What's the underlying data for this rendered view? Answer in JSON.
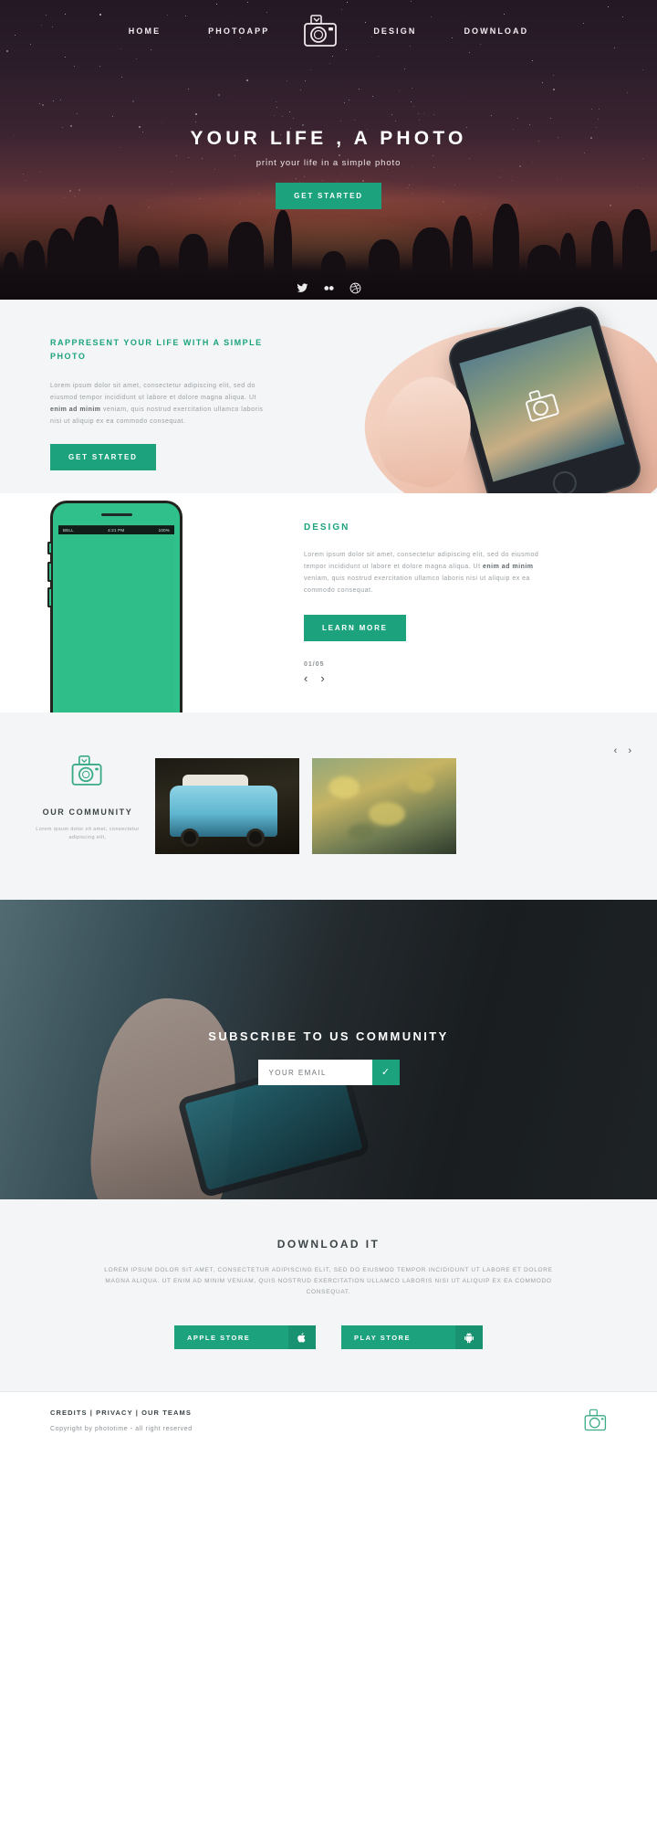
{
  "theme": {
    "accent": "#1CA37E",
    "light_bg": "#f3f5f6",
    "dark_text": "#3d4548"
  },
  "nav": {
    "logo_icon": "camera-icon",
    "items": [
      {
        "label": "HOME"
      },
      {
        "label": "PHOTOAPP"
      },
      {
        "label": "DESIGN"
      },
      {
        "label": "DOWNLOAD"
      }
    ]
  },
  "hero": {
    "title": "YOUR LIFE , A PHOTO",
    "subtitle": "print your life in a simple photo",
    "cta_label": "GET STARTED",
    "social": [
      {
        "name": "twitter-icon"
      },
      {
        "name": "flickr-icon"
      },
      {
        "name": "dribbble-icon"
      }
    ]
  },
  "rappresent": {
    "eyebrow": "RAPPRESENT YOUR LIFE WITH A SIMPLE PHOTO",
    "paragraph_pre": "Lorem ipsum dolor sit amet, consectetur adipiscing elit, sed do eiusmod tempor incididunt ut labore et dolore magna aliqua. Ut ",
    "paragraph_bold": "enim ad minim",
    "paragraph_post": " veniam, quis nostrud exercitation ullamco laboris nisi ut aliquip ex ea commodo consequat.",
    "cta_label": "GET STARTED"
  },
  "design": {
    "title": "DESIGN",
    "paragraph_pre": "Lorem ipsum dolor sit amet, consectetur adipiscing elit, sed do eiusmod tempor incididunt ut labore et dolore magna aliqua. Ut ",
    "paragraph_bold": "enim ad minim",
    "paragraph_post": " veniam, quis nostrud exercitation ullamco laboris nisi ut aliquip ex ea commodo consequat.",
    "cta_label": "LEARN MORE",
    "carousel_count": "01/05",
    "prev_arrow": "‹",
    "next_arrow": "›",
    "phone_status": {
      "carrier": "BELL",
      "time": "4:21 PM",
      "battery": "100%"
    }
  },
  "community": {
    "icon": "camera-icon",
    "title": "OUR COMMUNITY",
    "paragraph": "Lorem ipsum dolor sit amet, consectetur adipiscing elit,",
    "prev_arrow": "‹",
    "next_arrow": "›",
    "cards": [
      {
        "name": "van-photo"
      },
      {
        "name": "leaves-photo"
      }
    ]
  },
  "subscribe": {
    "title": "SUBSCRIBE TO US COMMUNITY",
    "input_placeholder": "YOUR EMAIL",
    "input_value": "",
    "submit_icon": "✓"
  },
  "download": {
    "title": "DOWNLOAD IT",
    "paragraph": "LOREM IPSUM DOLOR SIT AMET, CONSECTETUR ADIPISCING ELIT, SED DO EIUSMOD TEMPOR INCIDIDUNT UT LABORE ET DOLORE MAGNA ALIQUA. UT ENIM AD MINIM VENIAM, QUIS NOSTRUD EXERCITATION ULLAMCO LABORIS NISI UT ALIQUIP EX EA COMMODO CONSEQUAT.",
    "buttons": [
      {
        "label": "APPLE STORE",
        "icon": "apple-icon"
      },
      {
        "label": "PLAY STORE",
        "icon": "android-icon"
      }
    ]
  },
  "footer": {
    "links": "CREDITS | PRIVACY | OUR TEAMS",
    "copyright": "Copyright by phototime - all right reserved",
    "logo_icon": "camera-icon"
  }
}
